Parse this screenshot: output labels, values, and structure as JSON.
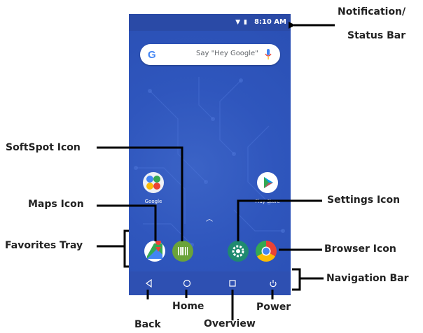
{
  "status_bar": {
    "time": "8:10 AM"
  },
  "search_bar": {
    "hint": "Say \"Hey Google\""
  },
  "apps": {
    "google_folder_label": "Google",
    "play_store_label": "Play Store"
  },
  "callouts": {
    "notification_line1": "Notification/",
    "notification_line2": "Status Bar",
    "softspot": "SoftSpot Icon",
    "maps": "Maps Icon",
    "favorites": "Favorites Tray",
    "settings": "Settings Icon",
    "browser": "Browser Icon",
    "navigation": "Navigation Bar",
    "home": "Home",
    "power": "Power",
    "back": "Back",
    "overview": "Overview"
  },
  "colors": {
    "wallpaper": "#2f56bd",
    "status_bar_bg": "#2a4aa6",
    "softspot_green": "#6aa33a",
    "settings_teal": "#1f8a70",
    "line": "#000000"
  }
}
